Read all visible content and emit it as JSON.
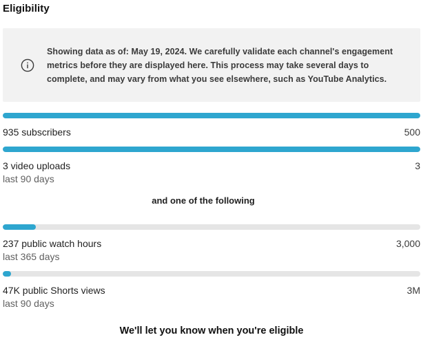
{
  "title": "Eligibility",
  "info": {
    "icon": "info-icon",
    "text": "Showing data as of: May 19, 2024. We carefully validate each channel's engagement metrics before they are displayed here. This process may take several days to complete, and may vary from what you see elsewhere, such as YouTube Analytics."
  },
  "colors": {
    "bar_fill": "#2ea6cf",
    "bar_track": "#e5e5e5",
    "info_bg": "#f2f2f2"
  },
  "metrics_required": [
    {
      "label": "935 subscribers",
      "target": "500",
      "sub": "",
      "progress": 1.0
    },
    {
      "label": "3 video uploads",
      "target": "3",
      "sub": "last 90 days",
      "progress": 1.0
    }
  ],
  "divider_text": "and one of the following",
  "metrics_optional": [
    {
      "label": "237 public watch hours",
      "target": "3,000",
      "sub": "last 365 days",
      "progress": 0.079
    },
    {
      "label": "47K public Shorts views",
      "target": "3M",
      "sub": "last 90 days",
      "progress": 0.0157
    }
  ],
  "footer": "We'll let you know when you're eligible"
}
